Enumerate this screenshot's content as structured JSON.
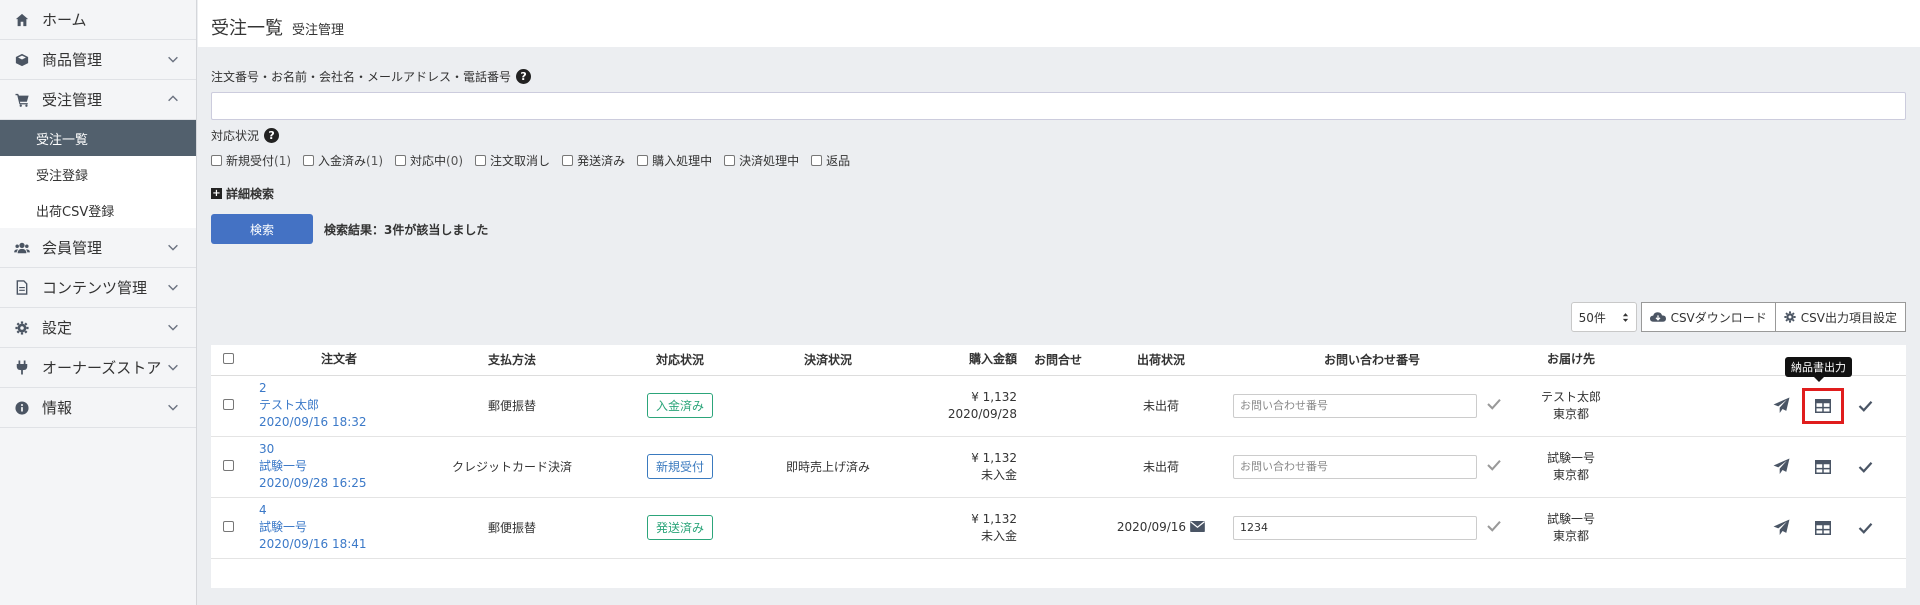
{
  "sidebar": {
    "items": [
      {
        "label": "ホーム",
        "icon": "home-icon",
        "chevron": false
      },
      {
        "label": "商品管理",
        "icon": "cube-icon",
        "chevron": "down"
      },
      {
        "label": "受注管理",
        "icon": "cart-icon",
        "chevron": "up"
      },
      {
        "label": "会員管理",
        "icon": "users-icon",
        "chevron": "down"
      },
      {
        "label": "コンテンツ管理",
        "icon": "file-icon",
        "chevron": "down"
      },
      {
        "label": "設定",
        "icon": "gear-icon",
        "chevron": "down"
      },
      {
        "label": "オーナーズストア",
        "icon": "plug-icon",
        "chevron": "down"
      },
      {
        "label": "情報",
        "icon": "info-icon",
        "chevron": "down"
      }
    ],
    "order_sub": [
      {
        "label": "受注一覧",
        "active": true
      },
      {
        "label": "受注登録",
        "active": false
      },
      {
        "label": "出荷CSV登録",
        "active": false
      }
    ]
  },
  "header": {
    "title": "受注一覧",
    "subtitle": "受注管理"
  },
  "search": {
    "label": "注文番号・お名前・会社名・メールアドレス・電話番号",
    "value": "",
    "status_label": "対応状況",
    "statuses": [
      {
        "label": "新規受付",
        "count": "(1)"
      },
      {
        "label": "入金済み",
        "count": "(1)"
      },
      {
        "label": "対応中",
        "count": "(0)"
      },
      {
        "label": "注文取消し",
        "count": ""
      },
      {
        "label": "発送済み",
        "count": ""
      },
      {
        "label": "購入処理中",
        "count": ""
      },
      {
        "label": "決済処理中",
        "count": ""
      },
      {
        "label": "返品",
        "count": ""
      }
    ],
    "detail_label": "詳細検索",
    "button_label": "検索",
    "result_text": "検索結果：3件が該当しました"
  },
  "toolbar": {
    "per_page": "50件",
    "csv_download": "CSVダウンロード",
    "csv_settings": "CSV出力項目設定"
  },
  "table": {
    "headers": [
      "注文者",
      "支払方法",
      "対応状況",
      "決済状況",
      "購入金額",
      "お問合せ",
      "出荷状況",
      "お問い合わせ番号",
      "お届け先"
    ],
    "tracking_placeholder": "お問い合わせ番号",
    "rows": [
      {
        "order_no": "2",
        "name": "テスト太郎",
        "date": "2020/09/16 18:32",
        "payment": "郵便振替",
        "status": "入金済み",
        "status_color": "#2ca57a",
        "settlement": "",
        "amount": "¥ 1,132",
        "paid": "2020/09/28",
        "inquiry": "",
        "shipping": "未出荷",
        "tracking": "",
        "dest_name": "テスト太郎",
        "dest_pref": "東京都"
      },
      {
        "order_no": "30",
        "name": "試験一号",
        "date": "2020/09/28 16:25",
        "payment": "クレジットカード決済",
        "status": "新規受付",
        "status_color": "#3a7abf",
        "settlement": "即時売上げ済み",
        "amount": "¥ 1,132",
        "paid": "未入金",
        "inquiry": "",
        "shipping": "未出荷",
        "tracking": "",
        "dest_name": "試験一号",
        "dest_pref": "東京都"
      },
      {
        "order_no": "4",
        "name": "試験一号",
        "date": "2020/09/16 18:41",
        "payment": "郵便振替",
        "status": "発送済み",
        "status_color": "#2ca57a",
        "settlement": "",
        "amount": "¥ 1,132",
        "paid": "未入金",
        "inquiry": "",
        "shipping": "2020/09/16",
        "tracking": "1234",
        "dest_name": "試験一号",
        "dest_pref": "東京都"
      }
    ],
    "tooltip": "納品書出力"
  }
}
